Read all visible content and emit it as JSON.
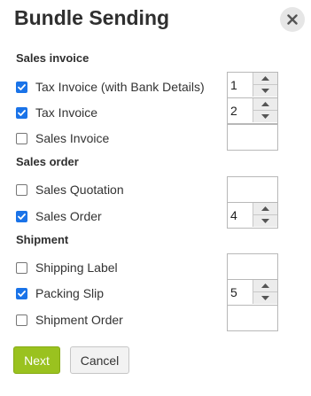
{
  "dialog": {
    "title": "Bundle Sending",
    "close_icon": "close-icon"
  },
  "sections": {
    "sales_invoice": {
      "title": "Sales invoice",
      "items": [
        {
          "label": "Tax Invoice (with Bank Details)",
          "checked": true,
          "quantity": "1"
        },
        {
          "label": "Tax Invoice",
          "checked": true,
          "quantity": "2"
        },
        {
          "label": "Sales Invoice",
          "checked": false,
          "quantity": ""
        }
      ]
    },
    "sales_order": {
      "title": "Sales order",
      "items": [
        {
          "label": "Sales Quotation",
          "checked": false,
          "quantity": ""
        },
        {
          "label": "Sales Order",
          "checked": true,
          "quantity": "4"
        }
      ]
    },
    "shipment": {
      "title": "Shipment",
      "items": [
        {
          "label": "Shipping Label",
          "checked": false,
          "quantity": ""
        },
        {
          "label": "Packing Slip",
          "checked": true,
          "quantity": "5"
        },
        {
          "label": "Shipment Order",
          "checked": false,
          "quantity": ""
        }
      ]
    }
  },
  "buttons": {
    "next_label": "Next",
    "cancel_label": "Cancel"
  },
  "colors": {
    "accent_next": "#9ac21f",
    "checkbox_checked": "#1a73e8"
  }
}
